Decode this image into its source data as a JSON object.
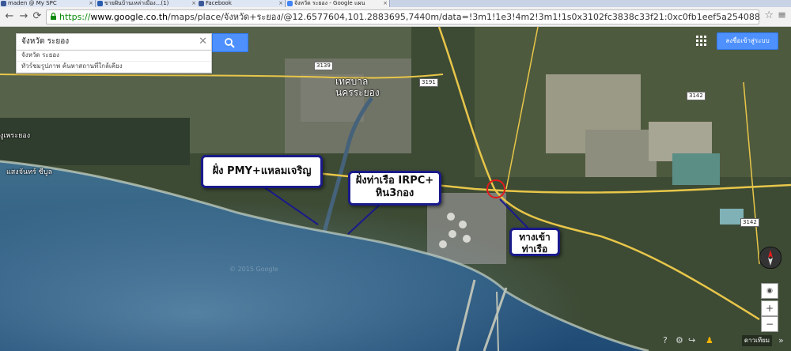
{
  "tabs": [
    {
      "label": "maden @ My SPC",
      "color": "#3b5998",
      "active": false
    },
    {
      "label": "ขายฝันบ้านเหล่าเมือง...(1)",
      "color": "#2a5db0",
      "active": false
    },
    {
      "label": "Facebook",
      "color": "#3b5998",
      "active": false
    },
    {
      "label": "จังหวัด ระยอง - Google แผน",
      "color": "#4285f4",
      "active": true
    }
  ],
  "address_bar": {
    "scheme": "https://",
    "domain": "www.google.co.th",
    "path": "/maps/place/จังหวัด+ระยอง/@12.6577604,101.2883695,7440m/data=!3m1!1e3!4m2!3m1!1s0x3102fc3838c33f21:0xc0fb1eef5a254088"
  },
  "search": {
    "query": "จังหวัด ระยอง",
    "suggestions": [
      "จังหวัด ระยอง",
      "ทัวร์ชมรูปภาพ   ค้นหาสถานที่ใกล้เคียง"
    ]
  },
  "signin_label": "ลงชื่อเข้าสู่ระบบ",
  "callouts": {
    "c1": "ฝั่ง PMY+แหลมเจริญ",
    "c2_line1": "ฝั่งท่าเรือ IRPC+",
    "c2_line2": "หิน3กอง",
    "c3_line1": "ทางเข้า",
    "c3_line2": "ท่าเรือ"
  },
  "map_labels": {
    "municipality_1": "เทศบาล",
    "municipality_2": "นครระยอง",
    "beach": "แสงจันทร์ ซีบูล",
    "town_left": "งูเพระยอง",
    "road_3139": "3139",
    "road_3191": "3191",
    "road_3142": "3142",
    "road_3142b": "3142",
    "watermark": "© 2015 Google"
  },
  "bottom": {
    "satellite_label": "ดาวเทียม"
  },
  "colors": {
    "accent": "#4d90fe",
    "callout_border": "#1a1a8a",
    "marker": "#e21b1b"
  }
}
